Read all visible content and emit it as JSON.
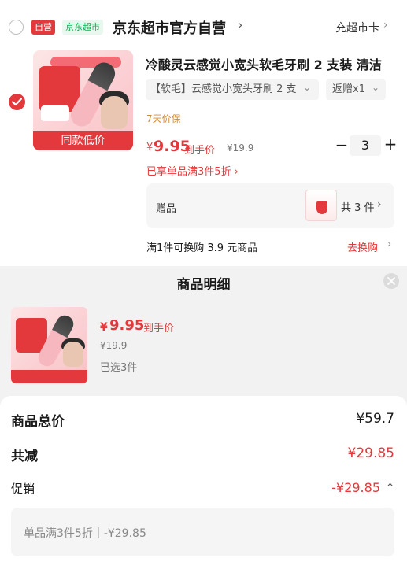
{
  "store": {
    "tag_self": "自营",
    "tag_market": "京东超市",
    "name": "京东超市官方自营",
    "chevron": "›",
    "card_link": "充超市卡",
    "card_chevron": "›"
  },
  "product": {
    "image_badge": "同款低价",
    "title": "冷酸灵云感觉小宽头软毛牙刷 2 支装 清洁",
    "spec": "【软毛】云感觉小宽头牙刷 2 支",
    "spec_chevron": "⌄",
    "gift_spec": "返赠x1",
    "gift_chevron": "⌄",
    "guarantee": "7天价保",
    "price_symbol": "¥",
    "price": "9.95",
    "price_label": "到手价",
    "original_price": "¥19.9",
    "quantity": "3",
    "minus": "−",
    "plus": "+",
    "promo": "已享单品满3件5折 ›",
    "gifts_label": "赠品",
    "gifts_count": "共 3 件",
    "gifts_chevron": "›",
    "redeem_text": "满1件可换购 3.9 元商品",
    "redeem_link": "去换购",
    "redeem_chevron": "›"
  },
  "detail": {
    "title": "商品明细",
    "price_symbol": "¥",
    "price": "9.95",
    "price_label": "到手价",
    "original_price": "¥19.9",
    "selected": "已选3件"
  },
  "totals": {
    "total_label": "商品总价",
    "total_value": "¥59.7",
    "discount_label": "共减",
    "discount_value": "¥29.85",
    "promo_label": "促销",
    "promo_value": "-¥29.85",
    "promo_chevron": "^",
    "promo_detail": "单品满3件5折丨-¥29.85"
  },
  "colors": {
    "accent_red": "#e4393c",
    "market_green": "#1aad55",
    "guarantee_orange": "#d68a2e"
  },
  "icons": [
    "radio-unchecked-icon",
    "radio-checked-icon",
    "close-icon",
    "chevron-right-icon",
    "chevron-down-icon",
    "chevron-up-icon",
    "gift-shield-icon"
  ]
}
